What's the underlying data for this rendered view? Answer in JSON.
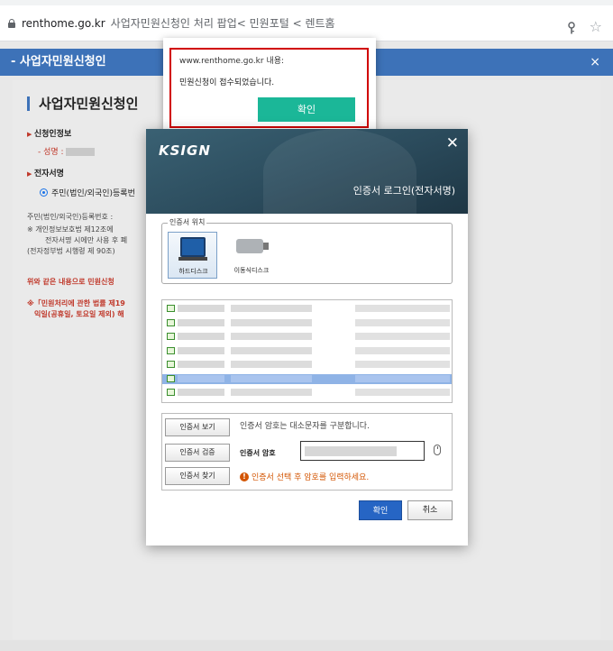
{
  "browser": {
    "domain": "renthome.go.kr",
    "page_title": "사업자민원신청인 처리 팝업< 민원포털 < 렌트홈"
  },
  "page": {
    "header_title": "- 사업자민원신청인",
    "header_close": "×",
    "title": "사업자민원신청인",
    "section_applicant": "신청인정보",
    "name_label": "- 성명 :",
    "section_signature": "전자서명",
    "radio_label": "주민(법인/외국인)등록번",
    "reg_line": "주민(법인/외국인)등록번호 :",
    "note_1": "※ 개인정보보호법 제12조에",
    "note_2": "전자서명 시에만 사용 후 폐",
    "note_3": "(전자정부법 시행령 제 90조)",
    "confirm_line": "위와 같은 내용으로 민원신청",
    "law_line_1": "※「민원처리에 관한 법률 제19",
    "law_line_2": "익일(공휴일, 토요일 제외) 해"
  },
  "alert": {
    "origin": "www.renthome.go.kr 내용:",
    "message": "민원신청이 접수되었습니다.",
    "ok_label": "확인"
  },
  "ksign": {
    "logo": "KSIGN",
    "close": "✕",
    "banner_title": "인증서 로그인(전자서명)",
    "location_legend": "인증서 위치",
    "hdd_label": "하드디스크",
    "usb_label": "이동식디스크",
    "rows": 7,
    "selected_row": 5,
    "btn_view": "인증서 보기",
    "btn_verify": "인증서 검증",
    "btn_find": "인증서 찾기",
    "case_note": "인증서 암호는 대소문자를 구분합니다.",
    "pw_label": "인증서 암호",
    "warning": "인증서 선택 후 암호를 입력하세요.",
    "ok_label": "확인",
    "cancel_label": "취소"
  },
  "colors": {
    "accent_blue": "#3d72b8",
    "alert_ok": "#1bb798",
    "alert_border": "#d10000",
    "ksign_ok": "#2665c4"
  }
}
